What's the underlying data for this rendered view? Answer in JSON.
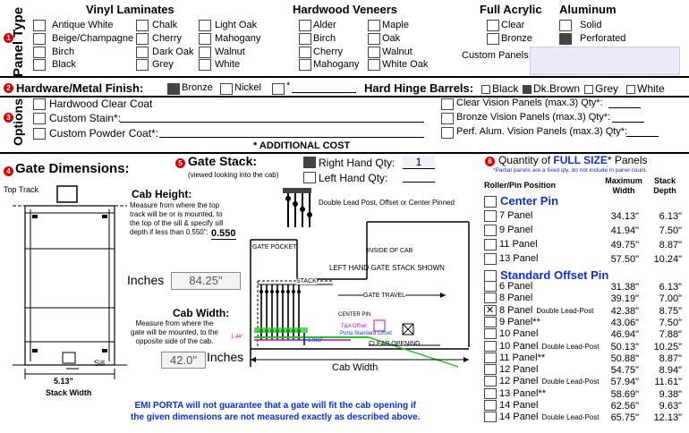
{
  "panel_type": {
    "side_label": "Panel Type",
    "badge": "1",
    "vinyl": {
      "title": "Vinyl Laminates",
      "items": [
        "Antique White",
        "Chalk",
        "Light Oak",
        "Beige/Champagne",
        "Cherry",
        "Mahogany",
        "Birch",
        "Dark Oak",
        "Walnut",
        "Black",
        "Grey",
        "White"
      ]
    },
    "hardwood": {
      "title": "Hardwood Veneers",
      "items": [
        "Alder",
        "Maple",
        "Birch",
        "Oak",
        "Cherry",
        "Walnut",
        "Mahogany",
        "White Oak"
      ]
    },
    "acrylic": {
      "title": "Full Acrylic",
      "items": [
        "Clear",
        "Bronze"
      ]
    },
    "aluminum": {
      "title": "Aluminum",
      "items": [
        "Solid",
        "Perforated"
      ]
    },
    "custom_panels_label": "Custom Panels:"
  },
  "hardware": {
    "badge": "2",
    "label": "Hardware/Metal Finish:",
    "options": [
      "Bronze",
      "Nickel",
      "*"
    ],
    "hinge_label": "Hard Hinge Barrels:",
    "hinge_options": [
      "Black",
      "Dk.Brown",
      "Grey",
      "White"
    ]
  },
  "options": {
    "side_label": "Options",
    "badge": "3",
    "left": [
      "Hardwood Clear Coat",
      "Custom Stain*:",
      "Custom Powder Coat*:"
    ],
    "right": [
      "Clear Vision Panels (max.3) Qty*:",
      "Bronze Vision Panels (max.3) Qty*:",
      "Perf. Alum. Vision Panels (max.3) Qty*:"
    ],
    "note": "* ADDITIONAL COST"
  },
  "gate_dimensions": {
    "badge": "4",
    "title": "Gate Dimensions:",
    "top_track": "Top Track",
    "sill": "Sill",
    "stack_width_value": "5.13\"",
    "stack_width_label": "Stack Width",
    "cab_height_title": "Cab Height:",
    "cab_height_desc": [
      "Measure from where the top",
      "track will be or is mounted, to",
      "the top of the sill & specify sill",
      "depth if less than 0.550\":"
    ],
    "sill_depth": "0.550",
    "inches_label": "Inches",
    "cab_height_value": "84.25\"",
    "cab_width_title": "Cab Width:",
    "cab_width_desc": [
      "Measure from where the",
      "gate will be mounted, to the",
      "opposite side of the cab."
    ],
    "cab_width_value": "42.0\"",
    "cab_width_inches": "Inches",
    "cab_width_bottom": "Cab Width",
    "warning": [
      "EMI PORTA will not guarantee that a gate will fit the cab opening if",
      "the given dimensions are not measured exactly as described above."
    ]
  },
  "gate_stack": {
    "badge": "5",
    "title": "Gate Stack:",
    "subtitle": "(viewed looking into the cab)",
    "right_hand_label": "Right Hand Qty:",
    "right_hand_qty": "1",
    "left_hand_label": "Left Hand Qty:",
    "double_lead": "Double Lead Post, Offset or Center Pinned",
    "diagram": {
      "gate_pocket": "GATE POCKET",
      "inside_cab": "INSIDE OF CAB",
      "stack_shown": "LEFT HAND GATE STACK SHOWN",
      "stack": "STACK",
      "gate_travel": "GATE TRAVEL",
      "center_pin": "CENTER PIN",
      "ta_offset": "T&A Offset",
      "porta_offset": "Porta Standard Offset",
      "clear_opening": "CLEAR OPENING",
      "dim1": "1.44\"",
      "dim2": "1.063\""
    }
  },
  "quantity": {
    "badge": "6",
    "title_prefix": "Quantity of ",
    "title_em": "FULL SIZE",
    "title_suffix": "* Panels",
    "note": "*Partial panels are a fixed qty, do not include in panel count.",
    "col_position": "Roller/Pin Position",
    "col_width": "Maximum Width",
    "col_depth": "Stack Depth",
    "center_pin_title": "Center Pin",
    "center_pin_rows": [
      {
        "label": "7 Panel",
        "width": "34.13\"",
        "depth": "6.13\""
      },
      {
        "label": "9 Panel",
        "width": "41.94\"",
        "depth": "7.50\""
      },
      {
        "label": "11 Panel",
        "width": "49.75\"",
        "depth": "8.87\""
      },
      {
        "label": "13 Panel",
        "width": "57.50\"",
        "depth": "10.24\""
      }
    ],
    "offset_title": "Standard Offset Pin",
    "offset_rows": [
      {
        "label": "6 Panel",
        "extra": "",
        "width": "31.38\"",
        "depth": "6.13\"",
        "checked": false
      },
      {
        "label": "8 Panel",
        "extra": "",
        "width": "39.19\"",
        "depth": "7.00\"",
        "checked": false
      },
      {
        "label": "8 Panel",
        "extra": "Double Lead-Post",
        "width": "42.38\"",
        "depth": "8.75\"",
        "checked": true
      },
      {
        "label": "9 Panel**",
        "extra": "",
        "width": "43.06\"",
        "depth": "7.50\"",
        "checked": false
      },
      {
        "label": "10 Panel",
        "extra": "",
        "width": "46.94\"",
        "depth": "7.88\"",
        "checked": false
      },
      {
        "label": "10 Panel",
        "extra": "Double Lead-Post",
        "width": "50.13\"",
        "depth": "10.25\"",
        "checked": false
      },
      {
        "label": "11 Panel**",
        "extra": "",
        "width": "50.88\"",
        "depth": "8.87\"",
        "checked": false
      },
      {
        "label": "12 Panel",
        "extra": "",
        "width": "54.75\"",
        "depth": "8.94\"",
        "checked": false
      },
      {
        "label": "12 Panel",
        "extra": "Double Lead-Post",
        "width": "57.94\"",
        "depth": "11.61\"",
        "checked": false
      },
      {
        "label": "13 Panel**",
        "extra": "",
        "width": "58.69\"",
        "depth": "9.38\"",
        "checked": false
      },
      {
        "label": "14 Panel",
        "extra": "",
        "width": "62.56\"",
        "depth": "9.63\"",
        "checked": false
      },
      {
        "label": "14 Panel",
        "extra": "Double Lead-Post",
        "width": "65.75\"",
        "depth": "12.13\"",
        "checked": false
      }
    ]
  }
}
